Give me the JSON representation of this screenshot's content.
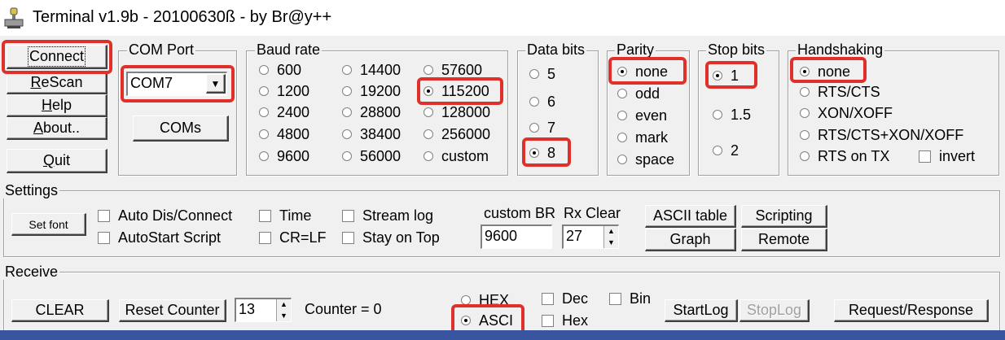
{
  "window": {
    "title": "Terminal v1.9b - 20100630ß - by Br@y++",
    "icon": "terminal-app-icon"
  },
  "buttons": {
    "connect": "Connect",
    "rescan_first": "R",
    "rescan_rest": "eScan",
    "help_first": "H",
    "help_rest": "elp",
    "about_first": "A",
    "about_rest": "bout..",
    "quit_first": "Q",
    "quit_rest": "uit",
    "coms": "COMs"
  },
  "com_port": {
    "label": "COM Port",
    "selected": "COM7"
  },
  "baud_rate": {
    "label": "Baud rate",
    "options": [
      "600",
      "1200",
      "2400",
      "4800",
      "9600",
      "14400",
      "19200",
      "28800",
      "38400",
      "56000",
      "57600",
      "115200",
      "128000",
      "256000",
      "custom"
    ],
    "selected": "115200"
  },
  "data_bits": {
    "label": "Data bits",
    "options": [
      "5",
      "6",
      "7",
      "8"
    ],
    "selected": "8"
  },
  "parity": {
    "label": "Parity",
    "options": [
      "none",
      "odd",
      "even",
      "mark",
      "space"
    ],
    "selected": "none"
  },
  "stop_bits": {
    "label": "Stop bits",
    "options": [
      "1",
      "1.5",
      "2"
    ],
    "selected": "1"
  },
  "handshaking": {
    "label": "Handshaking",
    "options": [
      "none",
      "RTS/CTS",
      "XON/XOFF",
      "RTS/CTS+XON/XOFF",
      "RTS on TX"
    ],
    "selected": "none",
    "invert_label": "invert"
  },
  "settings": {
    "label": "Settings",
    "set_font": "Set font",
    "auto_dis_connect": "Auto Dis/Connect",
    "autostart_script": "AutoStart Script",
    "time": "Time",
    "cr_lf": "CR=LF",
    "stream_log": "Stream log",
    "stay_on_top": "Stay on Top",
    "custom_br_label": "custom BR",
    "custom_br_value": "9600",
    "rx_clear_label": "Rx Clear",
    "rx_clear_value": "27",
    "ascii_table": "ASCII table",
    "scripting": "Scripting",
    "graph": "Graph",
    "remote": "Remote"
  },
  "receive": {
    "label": "Receive",
    "clear": "CLEAR",
    "reset_counter": "Reset Counter",
    "counter_spin_value": "13",
    "counter_text": "Counter = 0",
    "hex_radio": "HEX",
    "ascii_radio": "ASCI",
    "dec": "Dec",
    "bin": "Bin",
    "hex_check": "Hex",
    "startlog": "StartLog",
    "stoplog": "StopLog",
    "request_response": "Request/Response"
  },
  "colors": {
    "highlight": "#e0302a",
    "taskbar": "#3955a0",
    "window_bg": "#f0f0f0"
  }
}
